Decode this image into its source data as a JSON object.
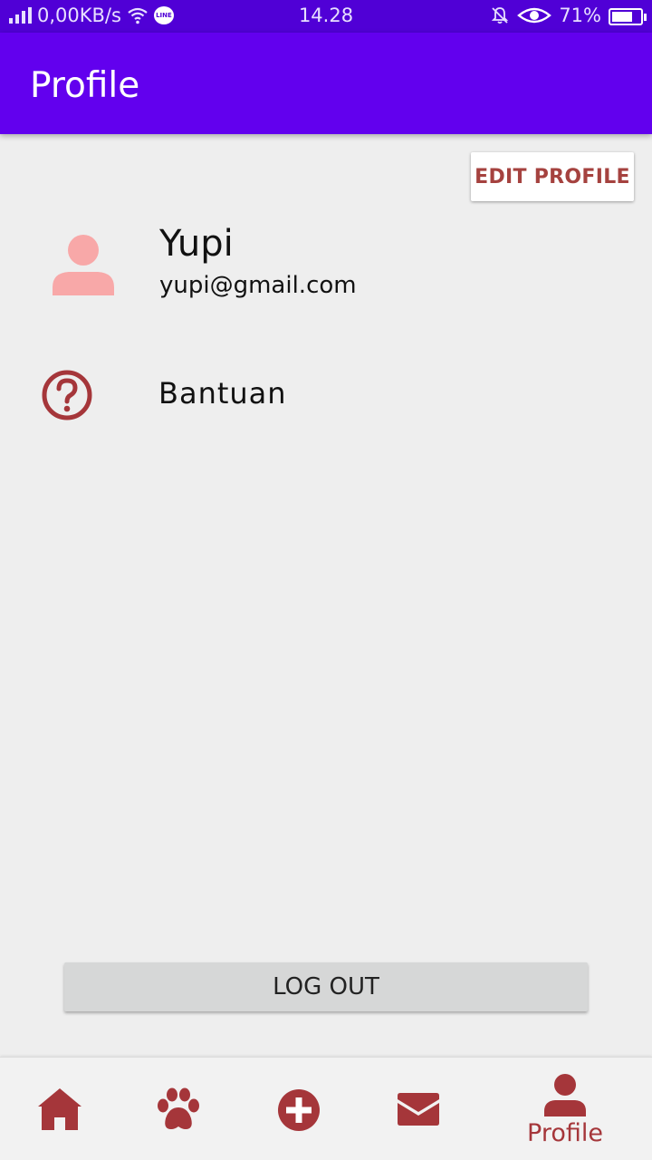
{
  "status_bar": {
    "network_speed": "0,00KB/s",
    "time": "14.28",
    "battery": "71%",
    "line_badge": "LINE"
  },
  "app_bar": {
    "title": "Profile"
  },
  "profile": {
    "edit_label": "EDIT PROFILE",
    "name": "Yupi",
    "email": "yupi@gmail.com"
  },
  "menu": {
    "help_label": "Bantuan"
  },
  "logout": {
    "label": "LOG OUT"
  },
  "bottom_nav": {
    "items": [
      {
        "icon": "home-icon",
        "label": ""
      },
      {
        "icon": "paw-icon",
        "label": ""
      },
      {
        "icon": "add-circle-icon",
        "label": ""
      },
      {
        "icon": "mail-icon",
        "label": ""
      },
      {
        "icon": "person-icon",
        "label": "Profile"
      }
    ],
    "active_index": 4
  },
  "colors": {
    "status_bar": "#5000d6",
    "app_bar": "#6200ee",
    "accent": "#a5363a",
    "avatar": "#f8a8a8",
    "background": "#eeeeee"
  }
}
